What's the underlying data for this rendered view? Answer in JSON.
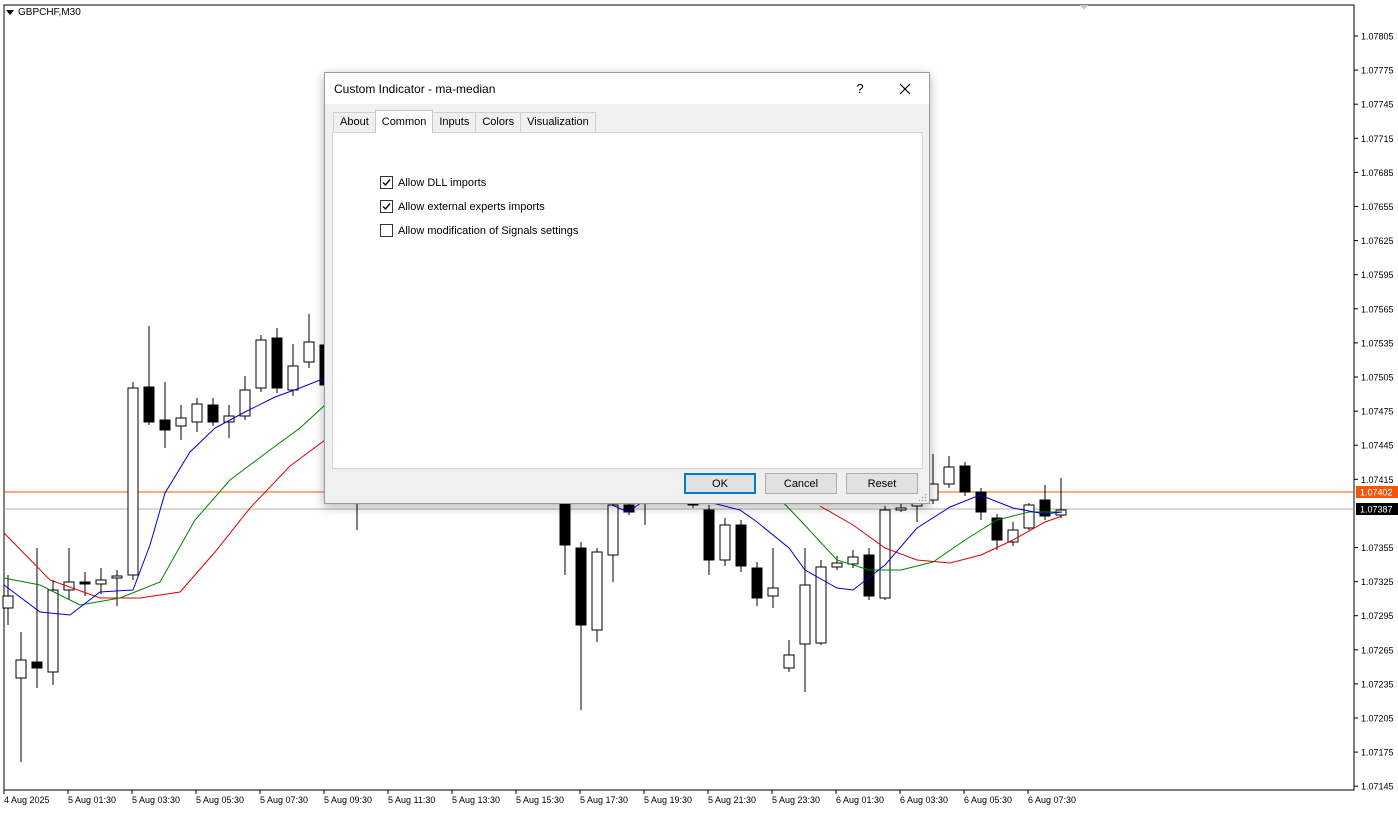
{
  "chart": {
    "symbol": "GBPCHF,M30",
    "price_labels": [
      "1.07805",
      "1.07775",
      "1.07745",
      "1.07715",
      "1.07685",
      "1.07655",
      "1.07625",
      "1.07595",
      "1.07565",
      "1.07535",
      "1.07505",
      "1.07475",
      "1.07445",
      "1.07415",
      "1.07355",
      "1.07325",
      "1.07295",
      "1.07265",
      "1.07235",
      "1.07205",
      "1.07175",
      "1.07145"
    ],
    "current_prices": [
      {
        "value": "1.07402",
        "color": "#f5560a"
      },
      {
        "value": "1.07387",
        "color": "#000000"
      }
    ],
    "time_labels": [
      "4 Aug 2025",
      "5 Aug 01:30",
      "5 Aug 03:30",
      "5 Aug 05:30",
      "5 Aug 07:30",
      "5 Aug 09:30",
      "5 Aug 11:30",
      "5 Aug 13:30",
      "5 Aug 15:30",
      "5 Aug 17:30",
      "5 Aug 19:30",
      "5 Aug 21:30",
      "5 Aug 23:30",
      "6 Aug 01:30",
      "6 Aug 03:30",
      "6 Aug 05:30",
      "6 Aug 07:30"
    ],
    "ma_colors": {
      "fast": "#0000cc",
      "mid": "#008000",
      "slow": "#dd0000"
    }
  },
  "dialog": {
    "title": "Custom Indicator - ma-median",
    "help_label": "?",
    "tabs": [
      {
        "label": "About",
        "active": false
      },
      {
        "label": "Common",
        "active": true
      },
      {
        "label": "Inputs",
        "active": false
      },
      {
        "label": "Colors",
        "active": false
      },
      {
        "label": "Visualization",
        "active": false
      }
    ],
    "options": [
      {
        "label": "Allow DLL imports",
        "checked": true
      },
      {
        "label": "Allow external experts imports",
        "checked": true
      },
      {
        "label": "Allow modification of Signals settings",
        "checked": false
      }
    ],
    "buttons": {
      "ok": "OK",
      "cancel": "Cancel",
      "reset": "Reset"
    }
  }
}
